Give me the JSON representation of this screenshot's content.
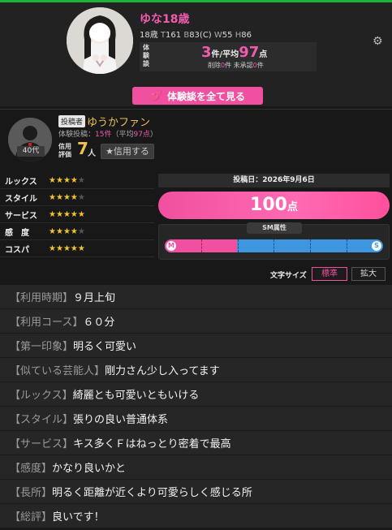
{
  "profile": {
    "name": "ゆな18歳",
    "age": "18歳",
    "t_key": "T",
    "t_val": "161",
    "b_key": "B",
    "b_val": "83(C)",
    "w_key": "W",
    "w_val": "55",
    "h_key": "H",
    "h_val": "86",
    "exp_label": "体験談",
    "exp_count": "3",
    "exp_count_unit": "件",
    "exp_avg_label": "/平均",
    "exp_avg": "97",
    "exp_avg_unit": "点",
    "deleted_label": "削除",
    "deleted_count": "0",
    "deleted_unit": "件",
    "unapproved_label": "未承認",
    "unapproved_count": "0",
    "unapproved_unit": "件",
    "view_all_label": "体験談を全て見る"
  },
  "poster": {
    "tag": "投稿者",
    "name": "ゆうかファン",
    "age_badge": "40代",
    "count_label": "体験投稿：",
    "count": "15件",
    "avg_prefix": "（平均",
    "avg": "97点",
    "avg_suffix": "）",
    "trust_label": "信用評価",
    "trust_value": "7",
    "trust_unit": "人",
    "trust_button": "★信用する"
  },
  "ratings": [
    {
      "label": "ルックス",
      "stars": 4
    },
    {
      "label": "スタイル",
      "stars": 4
    },
    {
      "label": "サービス",
      "stars": 5
    },
    {
      "label": "感　度",
      "stars": 4
    },
    {
      "label": "コスパ",
      "stars": 5
    }
  ],
  "review": {
    "post_date": "投稿日：2026年9月6日",
    "score": "100",
    "score_unit": "点",
    "sm_label": "SM属性",
    "sm_left": "M",
    "sm_right": "S",
    "sm_m_fraction": 0.33
  },
  "font_size": {
    "label": "文字サイズ",
    "standard": "標準",
    "large": "拡大"
  },
  "qa": [
    {
      "q": "【利用時期】",
      "a": "９月上旬"
    },
    {
      "q": "【利用コース】",
      "a": "６０分"
    },
    {
      "q": "【第一印象】",
      "a": "明るく可愛い"
    },
    {
      "q": "【似ている芸能人】",
      "a": "剛力さん少し入ってます"
    },
    {
      "q": "【ルックス】",
      "a": "綺麗とも可愛いともいける"
    },
    {
      "q": "【スタイル】",
      "a": "張りの良い普通体系"
    },
    {
      "q": "【サービス】",
      "a": "キス多くＦはねっとり密着で最高"
    },
    {
      "q": "【感度】",
      "a": "かなり良いかと"
    },
    {
      "q": "【長所】",
      "a": "明るく距離が近くより可愛らしく感じる所"
    },
    {
      "q": "【総評】",
      "a": "良いです！"
    }
  ],
  "colors": {
    "accent_pink": "#f0509f",
    "gold": "#f0c055",
    "sm_blue": "#3e96e0"
  }
}
